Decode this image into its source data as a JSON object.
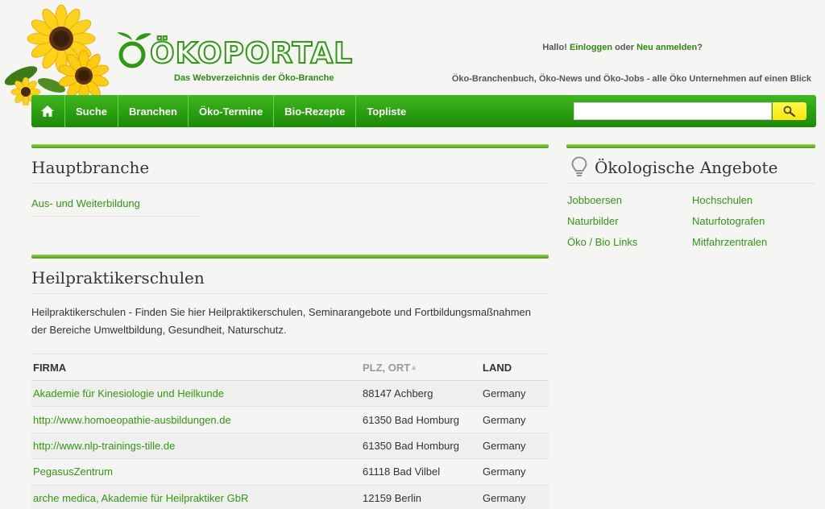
{
  "header": {
    "logo_text": "ÖKOPORTAL",
    "tagline": "Das Webverzeichnis der Öko-Branche",
    "login": {
      "greeting": "Hallo!",
      "login_link": "Einloggen",
      "or": "oder",
      "register_link": "Neu anmelden",
      "question": "?"
    },
    "slogan": "Öko-Branchenbuch, Öko-News und Öko-Jobs - alle Öko Unternehmen auf einen Blick"
  },
  "nav": {
    "home_icon": "home-icon",
    "items": [
      "Suche",
      "Branchen",
      "Öko-Termine",
      "Bio-Rezepte",
      "Topliste"
    ],
    "search_value": "",
    "search_icon": "search-icon"
  },
  "main_branch": {
    "title": "Hauptbranche",
    "link": "Aus- und Weiterbildung"
  },
  "category": {
    "title": "Heilpraktikerschulen",
    "description": "Heilpraktikerschulen - Finden Sie hier Heilpraktikerschulen, Seminarangebote und Fortbildungsmaßnahmen der Bereiche Umweltbildung, Gesundheit, Naturschutz.",
    "columns": [
      "FIRMA",
      "PLZ, ORT",
      "LAND"
    ],
    "sort_icon": "sort-up-icon",
    "rows": [
      {
        "firma": "Akademie für Kinesiologie und Heilkunde",
        "ort": "88147 Achberg",
        "land": "Germany"
      },
      {
        "firma": "http://www.homoeopathie-ausbildungen.de",
        "ort": "61350 Bad Homburg",
        "land": "Germany"
      },
      {
        "firma": "http://www.nlp-trainings-tille.de",
        "ort": "61350 Bad Homburg",
        "land": "Germany"
      },
      {
        "firma": "PegasusZentrum",
        "ort": "61118 Bad Vilbel",
        "land": "Germany"
      },
      {
        "firma": "arche medica, Akademie für Heilpraktiker GbR",
        "ort": "12159 Berlin",
        "land": "Germany"
      }
    ]
  },
  "offers": {
    "title": "Ökologische Angebote",
    "icon": "lightbulb-icon",
    "links": [
      "Jobboersen",
      "Hochschulen",
      "Naturbilder",
      "Naturfotografen",
      "Öko / Bio Links",
      "Mitfahrzentralen"
    ]
  },
  "colors": {
    "brand_green": "#2f9a10",
    "nav_green": "#2a9e10",
    "search_yellow": "#ffe600"
  }
}
